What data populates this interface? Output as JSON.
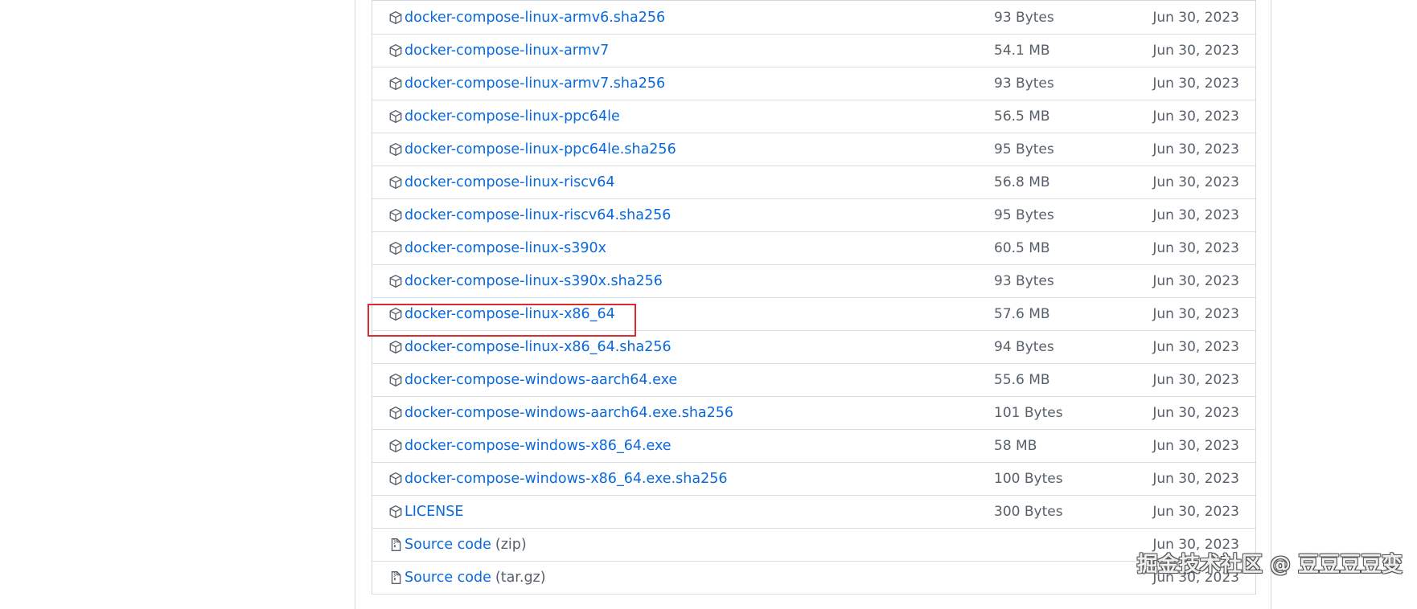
{
  "assets": [
    {
      "name": "docker-compose-linux-armv6.sha256",
      "size": "93 Bytes",
      "date": "Jun 30, 2023",
      "icon": "package-icon"
    },
    {
      "name": "docker-compose-linux-armv7",
      "size": "54.1 MB",
      "date": "Jun 30, 2023",
      "icon": "package-icon"
    },
    {
      "name": "docker-compose-linux-armv7.sha256",
      "size": "93 Bytes",
      "date": "Jun 30, 2023",
      "icon": "package-icon"
    },
    {
      "name": "docker-compose-linux-ppc64le",
      "size": "56.5 MB",
      "date": "Jun 30, 2023",
      "icon": "package-icon"
    },
    {
      "name": "docker-compose-linux-ppc64le.sha256",
      "size": "95 Bytes",
      "date": "Jun 30, 2023",
      "icon": "package-icon"
    },
    {
      "name": "docker-compose-linux-riscv64",
      "size": "56.8 MB",
      "date": "Jun 30, 2023",
      "icon": "package-icon"
    },
    {
      "name": "docker-compose-linux-riscv64.sha256",
      "size": "95 Bytes",
      "date": "Jun 30, 2023",
      "icon": "package-icon"
    },
    {
      "name": "docker-compose-linux-s390x",
      "size": "60.5 MB",
      "date": "Jun 30, 2023",
      "icon": "package-icon"
    },
    {
      "name": "docker-compose-linux-s390x.sha256",
      "size": "93 Bytes",
      "date": "Jun 30, 2023",
      "icon": "package-icon"
    },
    {
      "name": "docker-compose-linux-x86_64",
      "size": "57.6 MB",
      "date": "Jun 30, 2023",
      "icon": "package-icon",
      "highlighted": true
    },
    {
      "name": "docker-compose-linux-x86_64.sha256",
      "size": "94 Bytes",
      "date": "Jun 30, 2023",
      "icon": "package-icon"
    },
    {
      "name": "docker-compose-windows-aarch64.exe",
      "size": "55.6 MB",
      "date": "Jun 30, 2023",
      "icon": "package-icon"
    },
    {
      "name": "docker-compose-windows-aarch64.exe.sha256",
      "size": "101 Bytes",
      "date": "Jun 30, 2023",
      "icon": "package-icon"
    },
    {
      "name": "docker-compose-windows-x86_64.exe",
      "size": "58 MB",
      "date": "Jun 30, 2023",
      "icon": "package-icon"
    },
    {
      "name": "docker-compose-windows-x86_64.exe.sha256",
      "size": "100 Bytes",
      "date": "Jun 30, 2023",
      "icon": "package-icon"
    },
    {
      "name": "LICENSE",
      "size": "300 Bytes",
      "date": "Jun 30, 2023",
      "icon": "package-icon"
    },
    {
      "name": "Source code",
      "suffix": "(zip)",
      "size": "",
      "date": "Jun 30, 2023",
      "icon": "file-zip-icon"
    },
    {
      "name": "Source code",
      "suffix": "(tar.gz)",
      "size": "",
      "date": "Jun 30, 2023",
      "icon": "file-zip-icon"
    }
  ],
  "watermark": "掘金技术社区 @ 豆豆豆豆变",
  "colors": {
    "link": "#0969da",
    "muted": "#57606a",
    "border": "#d0d7de",
    "highlight": "#d92d2d"
  }
}
